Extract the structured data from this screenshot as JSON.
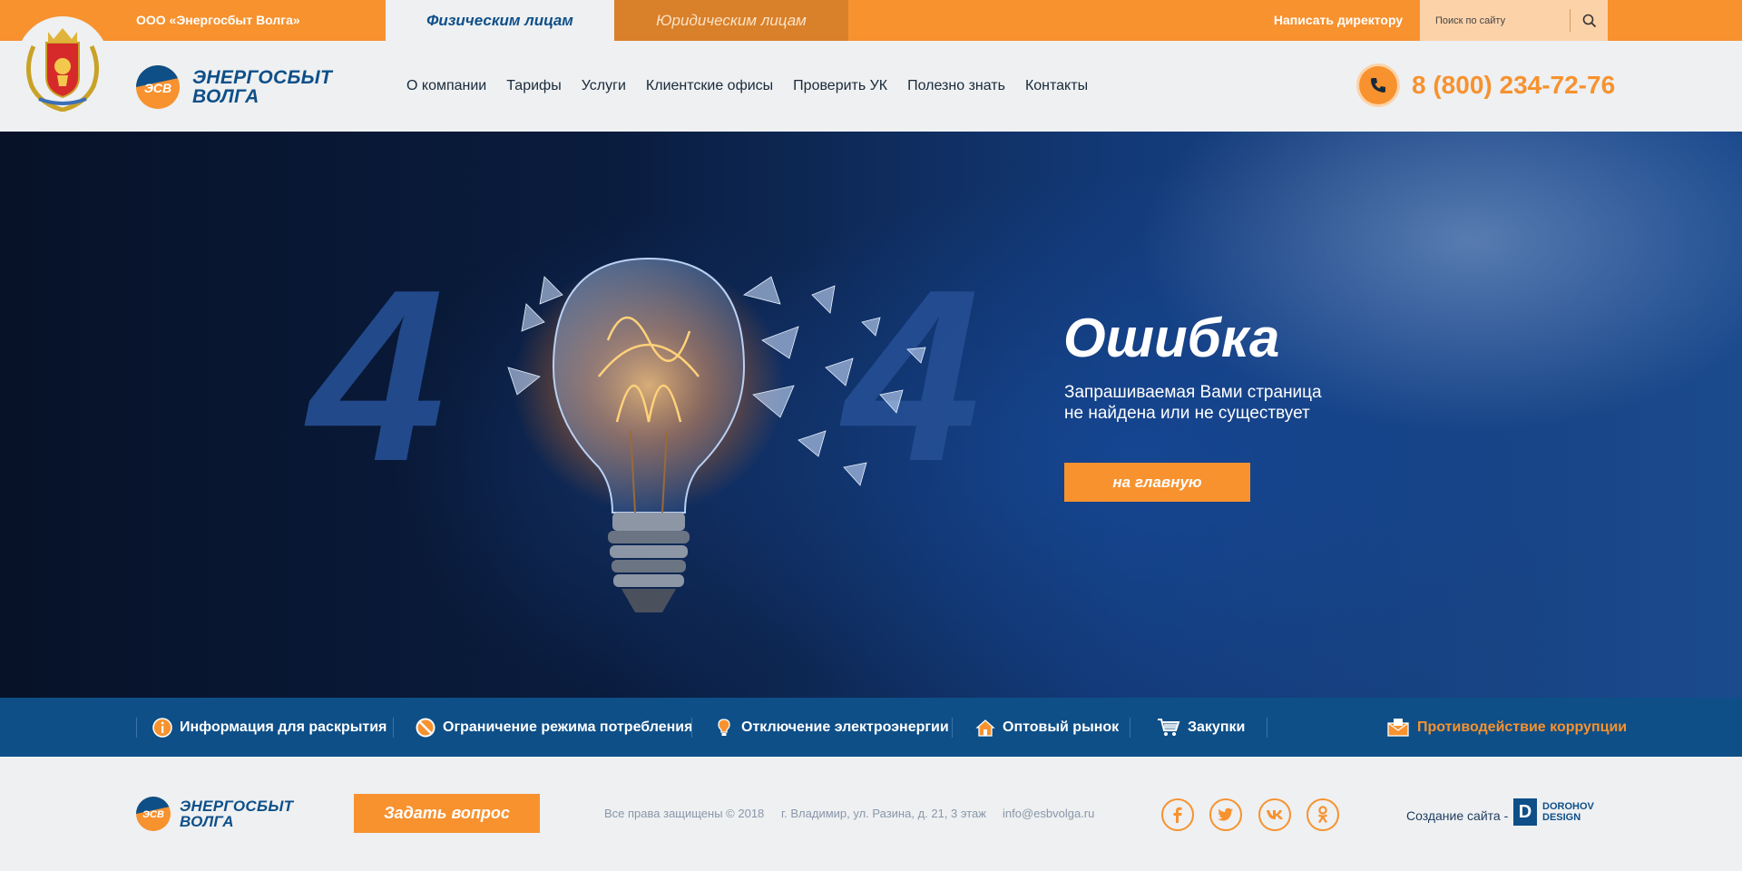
{
  "topbar": {
    "company": "ООО «Энергосбыт Волга»",
    "tabs": [
      {
        "label": "Физическим лицам",
        "active": true
      },
      {
        "label": "Юридическим лицам",
        "active": false
      }
    ],
    "write_director": "Написать директору",
    "search_placeholder": "Поиск по сайту"
  },
  "header": {
    "logo_line1": "ЭНЕРГОСБЫТ",
    "logo_line2": "ВОЛГА",
    "logo_mark": "ЭСВ",
    "nav": [
      "О компании",
      "Тарифы",
      "Услуги",
      "Клиентские офисы",
      "Проверить УК",
      "Полезно знать",
      "Контакты"
    ],
    "phone": "8 (800) 234-72-76"
  },
  "hero": {
    "digit_left": "4",
    "digit_right": "4",
    "title": "Ошибка",
    "text_line1": "Запрашиваемая Вами страница",
    "text_line2": "не найдена или не существует",
    "button": "на главную"
  },
  "linkbar": [
    {
      "label": "Информация для раскрытия",
      "icon": "info-icon"
    },
    {
      "label": "Ограничение режима потребления",
      "icon": "restriction-icon"
    },
    {
      "label": "Отключение электроэнергии",
      "icon": "bulb-icon"
    },
    {
      "label": "Оптовый рынок",
      "icon": "house-icon"
    },
    {
      "label": "Закупки",
      "icon": "cart-icon"
    },
    {
      "label": "Противодействие коррупции",
      "icon": "envelope-icon"
    }
  ],
  "footer": {
    "logo_line1": "ЭНЕРГОСБЫТ",
    "logo_line2": "ВОЛГА",
    "logo_mark": "ЭСВ",
    "ask_button": "Задать вопрос",
    "copyright": "Все права защищены © 2018",
    "address": "г. Владимир, ул. Разина, д. 21, 3 этаж",
    "email": "info@esbvolga.ru",
    "social": [
      "facebook-icon",
      "twitter-icon",
      "vk-icon",
      "odnoklassniki-icon"
    ],
    "made_by": "Создание сайта -",
    "designer_mark": "D",
    "designer_line1": "DOROHOV",
    "designer_line2": "DESIGN"
  },
  "colors": {
    "accent": "#f7922f",
    "brand": "#0e4f88",
    "background": "#eef0f2"
  }
}
